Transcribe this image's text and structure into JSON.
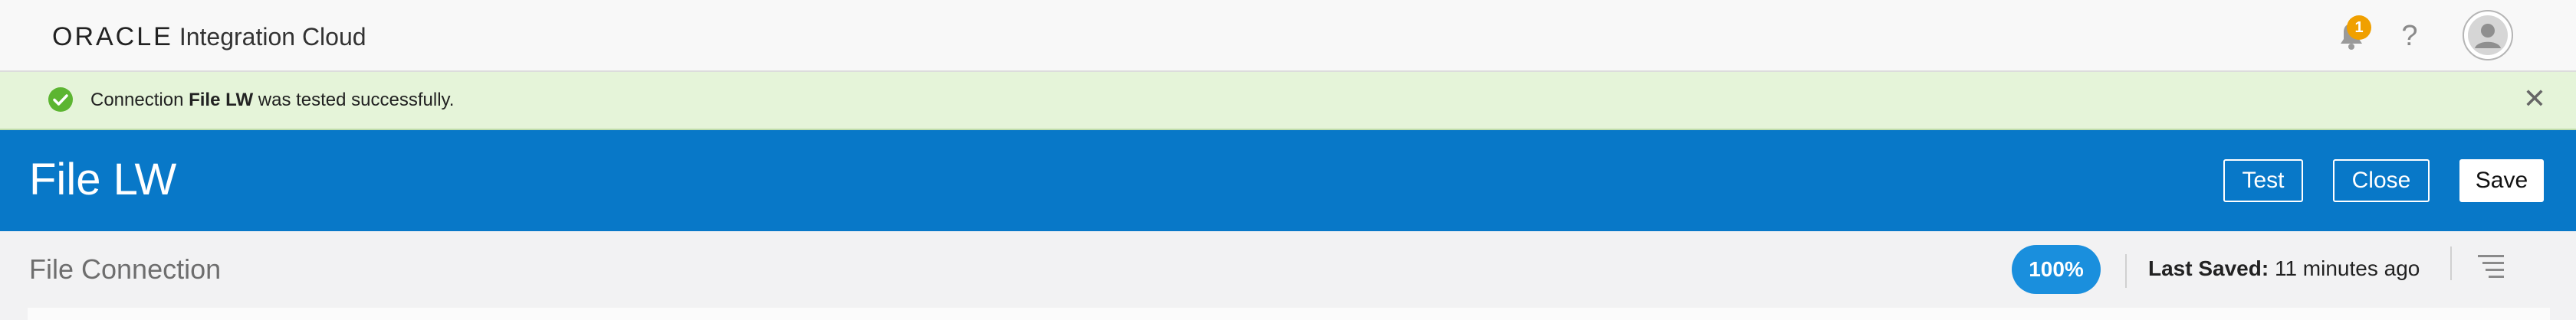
{
  "header": {
    "brand_oracle": "ORACLE",
    "brand_product": "Integration Cloud",
    "notifications_count": "1",
    "help_glyph": "?",
    "icons": [
      "bell-icon",
      "help-icon",
      "user-avatar-icon"
    ]
  },
  "banner": {
    "prefix": "Connection ",
    "connection_name": "File LW",
    "suffix": " was tested successfully.",
    "close_glyph": "✕",
    "status": "success",
    "colors": {
      "background": "#e5f4d9",
      "check": "#5cb531"
    }
  },
  "titlebar": {
    "title": "File LW",
    "test_label": "Test",
    "close_label": "Close",
    "save_label": "Save",
    "background": "#0878c8"
  },
  "subheader": {
    "title": "File Connection",
    "progress": "100%",
    "last_saved_label": "Last Saved:",
    "last_saved_value": " 11 minutes ago",
    "progress_color": "#1a8fdd"
  }
}
